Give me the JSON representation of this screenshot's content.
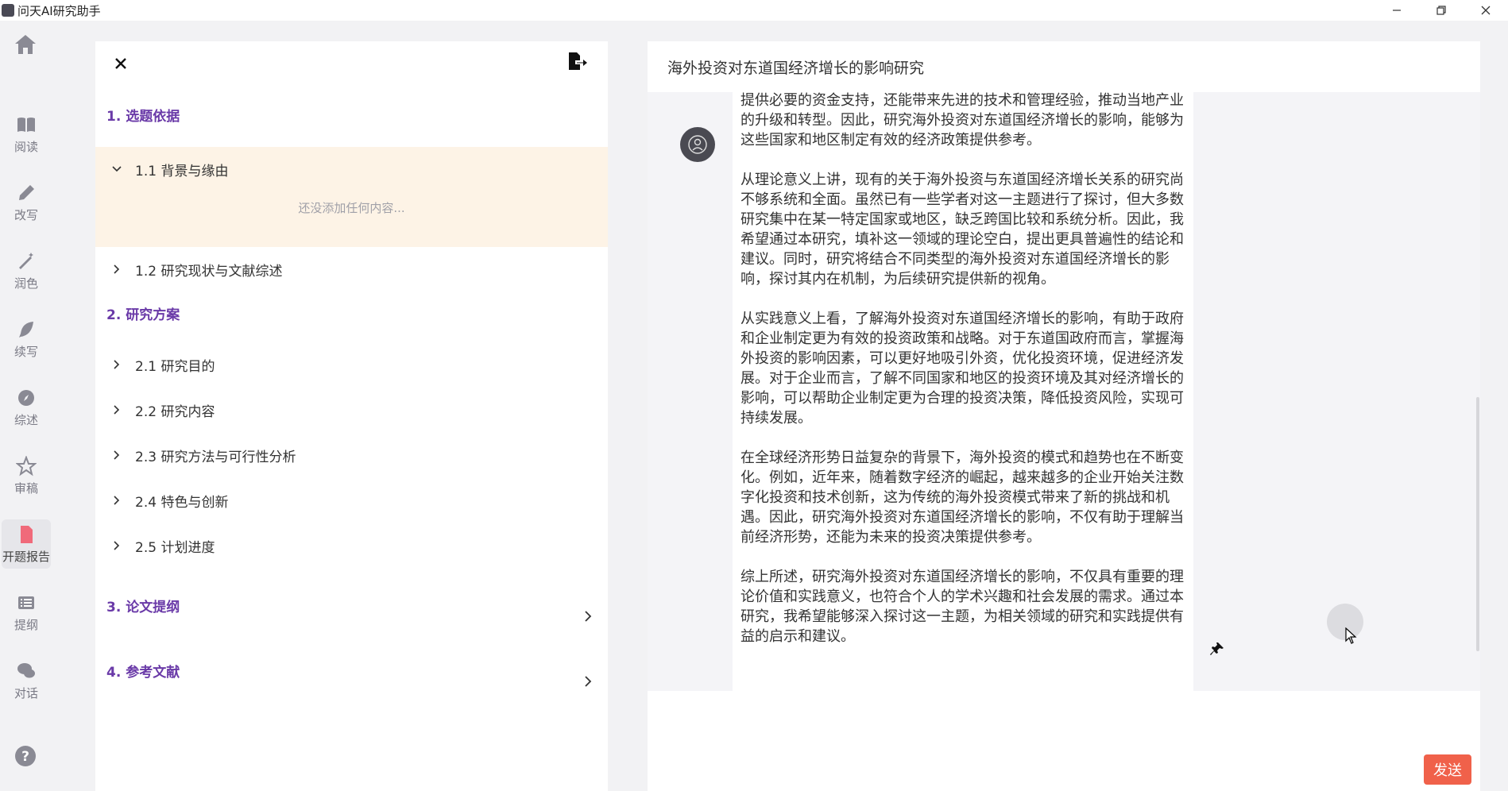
{
  "window": {
    "title": "问天AI研究助手",
    "controls": [
      "minimize-icon",
      "restore-icon",
      "close-icon"
    ]
  },
  "sidebar": {
    "items": [
      {
        "label": "阅读",
        "icon": "book-icon"
      },
      {
        "label": "改写",
        "icon": "pen-icon"
      },
      {
        "label": "润色",
        "icon": "magic-wand-icon"
      },
      {
        "label": "续写",
        "icon": "feather-icon"
      },
      {
        "label": "综述",
        "icon": "compass-icon"
      },
      {
        "label": "审稿",
        "icon": "star-icon"
      },
      {
        "label": "开题报告",
        "icon": "document-icon",
        "active": true
      },
      {
        "label": "提纲",
        "icon": "list-icon"
      },
      {
        "label": "对话",
        "icon": "chat-icon"
      }
    ]
  },
  "outline": {
    "sections": [
      {
        "title": "1. 选题依据"
      },
      {
        "title": "2. 研究方案"
      },
      {
        "title": "3. 论文提纲"
      },
      {
        "title": "4. 参考文献"
      }
    ],
    "subsections": {
      "s1_1": "1.1 背景与缘由",
      "s1_2": "1.2 研究现状与文献综述",
      "s2_1": "2.1 研究目的",
      "s2_2": "2.2 研究内容",
      "s2_3": "2.3 研究方法与可行性分析",
      "s2_4": "2.4 特色与创新",
      "s2_5": "2.5 计划进度"
    },
    "empty_hint": "还没添加任何内容..."
  },
  "chat": {
    "title": "海外投资对东道国经济增长的影响研究",
    "message_paragraphs": [
      "提供必要的资金支持，还能带来先进的技术和管理经验，推动当地产业的升级和转型。因此，研究海外投资对东道国经济增长的影响，能够为这些国家和地区制定有效的经济政策提供参考。",
      "从理论意义上讲，现有的关于海外投资与东道国经济增长关系的研究尚不够系统和全面。虽然已有一些学者对这一主题进行了探讨，但大多数研究集中在某一特定国家或地区，缺乏跨国比较和系统分析。因此，我希望通过本研究，填补这一领域的理论空白，提出更具普遍性的结论和建议。同时，研究将结合不同类型的海外投资对东道国经济增长的影响，探讨其内在机制，为后续研究提供新的视角。",
      "从实践意义上看，了解海外投资对东道国经济增长的影响，有助于政府和企业制定更为有效的投资政策和战略。对于东道国政府而言，掌握海外投资的影响因素，可以更好地吸引外资，优化投资环境，促进经济发展。对于企业而言，了解不同国家和地区的投资环境及其对经济增长的影响，可以帮助企业制定更为合理的投资决策，降低投资风险，实现可持续发展。",
      "在全球经济形势日益复杂的背景下，海外投资的模式和趋势也在不断变化。例如，近年来，随着数字经济的崛起，越来越多的企业开始关注数字化投资和技术创新，这为传统的海外投资模式带来了新的挑战和机遇。因此，研究海外投资对东道国经济增长的影响，不仅有助于理解当前经济形势，还能为未来的投资决策提供参考。",
      "综上所述，研究海外投资对东道国经济增长的影响，不仅具有重要的理论价值和实践意义，也符合个人的学术兴趣和社会发展的需求。通过本研究，我希望能够深入探讨这一主题，为相关领域的研究和实践提供有益的启示和建议。"
    ],
    "send_label": "发送"
  },
  "colors": {
    "accent_purple": "#6a3aa8",
    "expanded_bg": "#fdf3e6",
    "send_button": "#f0614a",
    "active_nav_icon": "#f06a7a"
  }
}
